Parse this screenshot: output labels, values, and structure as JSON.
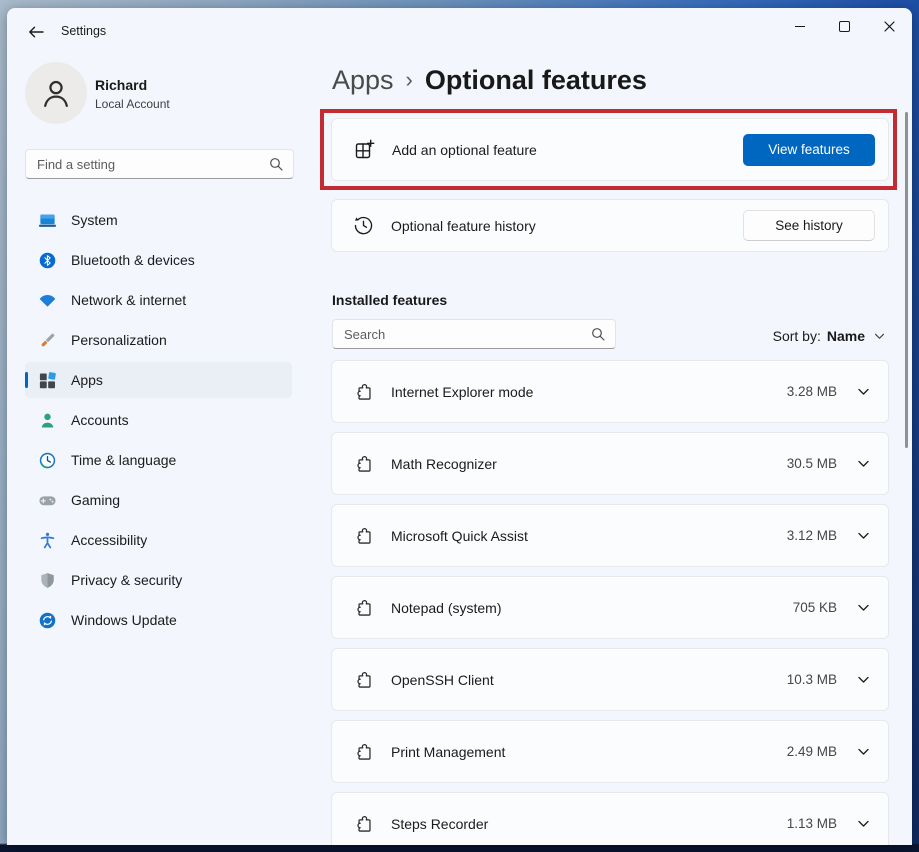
{
  "titlebar": {
    "title": "Settings"
  },
  "sidebar": {
    "user": {
      "name": "Richard",
      "type": "Local Account"
    },
    "search": {
      "placeholder": "Find a setting"
    },
    "selected_item": "Apps",
    "items": [
      {
        "label": "System",
        "icon": "system-icon"
      },
      {
        "label": "Bluetooth & devices",
        "icon": "bluetooth-icon"
      },
      {
        "label": "Network & internet",
        "icon": "network-icon"
      },
      {
        "label": "Personalization",
        "icon": "personalization-icon"
      },
      {
        "label": "Apps",
        "icon": "apps-icon"
      },
      {
        "label": "Accounts",
        "icon": "accounts-icon"
      },
      {
        "label": "Time & language",
        "icon": "time-language-icon"
      },
      {
        "label": "Gaming",
        "icon": "gaming-icon"
      },
      {
        "label": "Accessibility",
        "icon": "accessibility-icon"
      },
      {
        "label": "Privacy & security",
        "icon": "privacy-security-icon"
      },
      {
        "label": "Windows Update",
        "icon": "windows-update-icon"
      }
    ]
  },
  "main": {
    "breadcrumb": {
      "parent": "Apps",
      "separator": "›",
      "current": "Optional features"
    },
    "add_feature": {
      "label": "Add an optional feature",
      "button": "View features",
      "highlighted": true
    },
    "history": {
      "label": "Optional feature history",
      "button": "See history"
    },
    "installed": {
      "heading": "Installed features",
      "search_placeholder": "Search",
      "sort_label": "Sort by:",
      "sort_value": "Name",
      "features": [
        {
          "name": "Internet Explorer mode",
          "size": "3.28 MB"
        },
        {
          "name": "Math Recognizer",
          "size": "30.5 MB"
        },
        {
          "name": "Microsoft Quick Assist",
          "size": "3.12 MB"
        },
        {
          "name": "Notepad (system)",
          "size": "705 KB"
        },
        {
          "name": "OpenSSH Client",
          "size": "10.3 MB"
        },
        {
          "name": "Print Management",
          "size": "2.49 MB"
        },
        {
          "name": "Steps Recorder",
          "size": "1.13 MB"
        }
      ]
    }
  },
  "colors": {
    "accent": "#0067c0",
    "highlight_red": "#c22b31",
    "window_bg": "#f3f6fc"
  }
}
